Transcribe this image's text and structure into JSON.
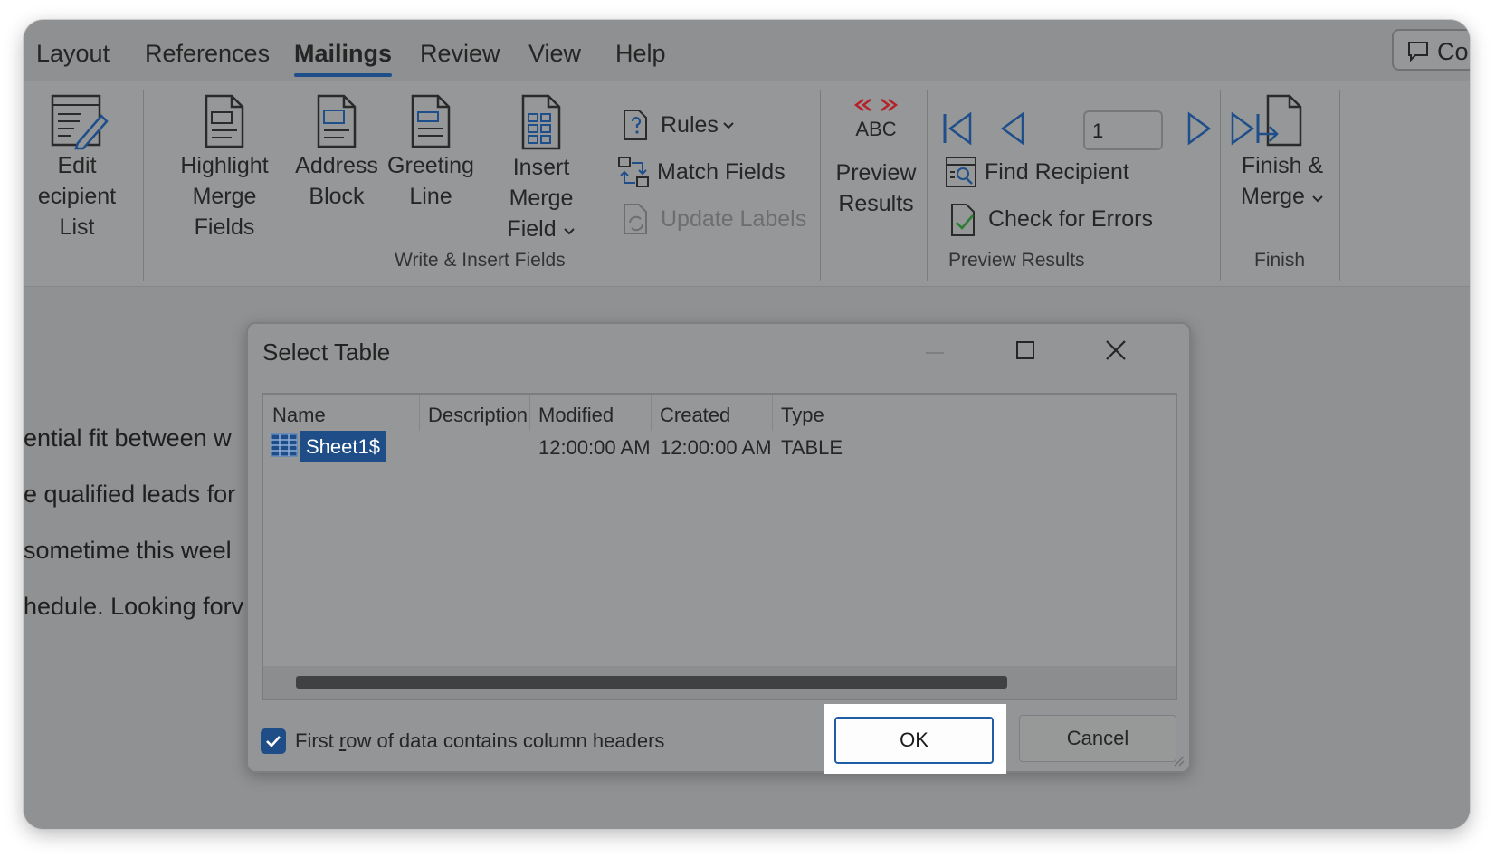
{
  "tabs": [
    "Layout",
    "References",
    "Mailings",
    "Review",
    "View",
    "Help"
  ],
  "active_tab": "Mailings",
  "comments_button": "Co",
  "ribbon": {
    "edit_recipient_list": [
      "Edit",
      "ecipient List"
    ],
    "highlight_merge_fields": [
      "Highlight",
      "Merge Fields"
    ],
    "address_block": [
      "Address",
      "Block"
    ],
    "greeting_line": [
      "Greeting",
      "Line"
    ],
    "insert_merge_field": [
      "Insert Merge",
      "Field"
    ],
    "rules": "Rules",
    "match_fields": "Match Fields",
    "update_labels": "Update Labels",
    "write_insert_group": "Write & Insert Fields",
    "preview_results_btn": [
      "Preview",
      "Results"
    ],
    "abc_label": "ABC",
    "record_number": "1",
    "find_recipient": "Find Recipient",
    "check_for_errors": "Check for Errors",
    "preview_results_group": "Preview Results",
    "finish_merge": [
      "Finish &",
      "Merge"
    ],
    "finish_group": "Finish"
  },
  "document_lines": [
    "ential fit between w",
    "e qualified leads for",
    "sometime this weel",
    "hedule. Looking forv"
  ],
  "dialog": {
    "title": "Select Table",
    "columns": [
      "Name",
      "Description",
      "Modified",
      "Created",
      "Type"
    ],
    "rows": [
      {
        "name": "Sheet1$",
        "description": "",
        "modified": "12:00:00 AM",
        "created": "12:00:00 AM",
        "type": "TABLE"
      }
    ],
    "checkbox_label_pre": "First ",
    "checkbox_label_underlined": "r",
    "checkbox_label_post": "ow of data contains column headers",
    "checkbox_checked": true,
    "ok_label": "OK",
    "cancel_label": "Cancel"
  },
  "colors": {
    "accent": "#1e4d87",
    "overlay_gray": "#8f9192",
    "highlight_box": "#ffffff"
  }
}
